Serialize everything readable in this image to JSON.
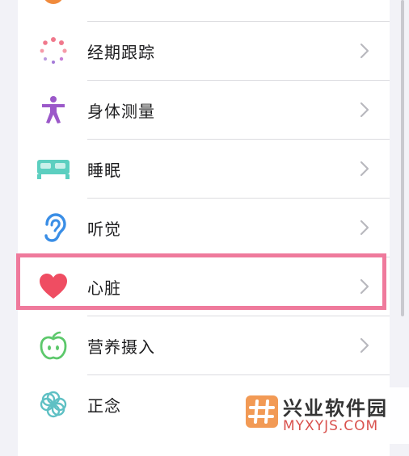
{
  "list": {
    "items": [
      {
        "label": "",
        "icon": "partial-orange-icon"
      },
      {
        "label": "经期跟踪",
        "icon": "cycle-tracking-icon"
      },
      {
        "label": "身体测量",
        "icon": "body-measurements-icon"
      },
      {
        "label": "睡眠",
        "icon": "sleep-bed-icon"
      },
      {
        "label": "听觉",
        "icon": "hearing-ear-icon"
      },
      {
        "label": "心脏",
        "icon": "heart-icon"
      },
      {
        "label": "营养摄入",
        "icon": "nutrition-apple-icon"
      },
      {
        "label": "正念",
        "icon": "mindfulness-flower-icon"
      }
    ],
    "highlighted_index": 5
  },
  "colors": {
    "heart": "#ef4d62",
    "sleep": "#5ccfc0",
    "hearing": "#3a8ee6",
    "body": "#9b58c9",
    "nutrition": "#5cc86b",
    "mindfulness": "#5ec0c4",
    "highlight": "#ef7a9c"
  },
  "watermark": {
    "name": "兴业软件园",
    "domain": "MYXYJS.COM"
  }
}
